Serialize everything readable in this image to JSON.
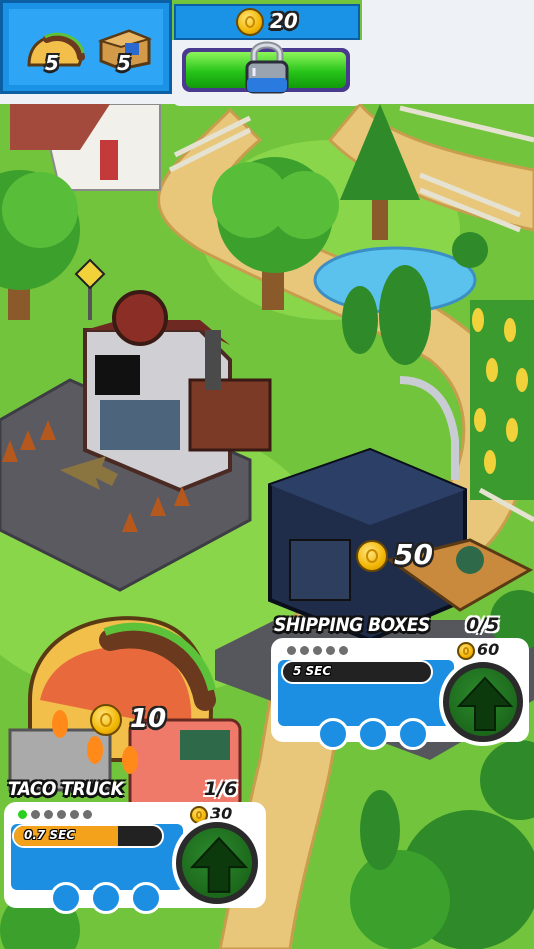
{
  "hud": {
    "taco_count": "5",
    "box_count": "5",
    "coins": "20",
    "unlock_icon": "padlock-icon"
  },
  "map_pickup": {
    "coin_value": "50"
  },
  "shipping": {
    "title": "SHIPPING BOXES",
    "progress": "0/5",
    "upgrade_cost": "60",
    "timer": "5 SEC",
    "timer_fill": 0,
    "level_dots_total": 5,
    "level_dots_filled": 0
  },
  "taco_truck": {
    "title": "TACO TRUCK",
    "progress": "1/6",
    "upgrade_cost": "30",
    "collect_value": "10",
    "timer": "0.7 SEC",
    "timer_fill": 0.7,
    "level_dots_total": 6,
    "level_dots_filled": 1
  },
  "colors": {
    "panel_blue": "#1d8fe3",
    "progress_green": "#27c41a",
    "timer_orange": "#f4a21c",
    "grass": "#6fbf3a"
  }
}
